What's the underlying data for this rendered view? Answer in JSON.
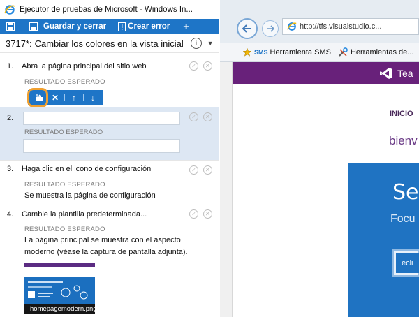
{
  "window": {
    "title": "Ejecutor de pruebas de Microsoft - Windows In..."
  },
  "toolbar": {
    "save_close_label": "Guardar y cerrar",
    "create_bug_label": "Crear error"
  },
  "test": {
    "id": "3717*:",
    "title": "Cambiar los colores en la vista inicial"
  },
  "expected_label": "RESULTADO ESPERADO",
  "steps": [
    {
      "number": "1.",
      "action": "Abra la página principal del sitio web",
      "expected": ""
    },
    {
      "number": "2.",
      "action": "",
      "expected": ""
    },
    {
      "number": "3.",
      "action": "Haga clic en el icono de configuración",
      "expected": "Se muestra la página de configuración"
    },
    {
      "number": "4.",
      "action": "Cambie la plantilla predeterminada...",
      "expected_line1": "La página principal se muestra con el aspecto",
      "expected_line2": "moderno (véase la captura de pantalla adjunta)."
    }
  ],
  "attachment": {
    "filename": "homepagemodern.png"
  },
  "browser": {
    "address": "http://tfs.visualstudio.c...",
    "favorites": [
      {
        "badge": "SMS",
        "label": "Herramienta SMS"
      },
      {
        "label": "Herramientas de..."
      }
    ],
    "page": {
      "header_text": "Tea",
      "nav_inicio": "INICIO",
      "welcome": "bienv",
      "hero_title": "Se",
      "hero_sub": "Focu",
      "button": "ecli"
    }
  },
  "colors": {
    "accent": "#1e75c7",
    "brand_purple": "#68217a",
    "highlight_ring": "#f0a030"
  }
}
